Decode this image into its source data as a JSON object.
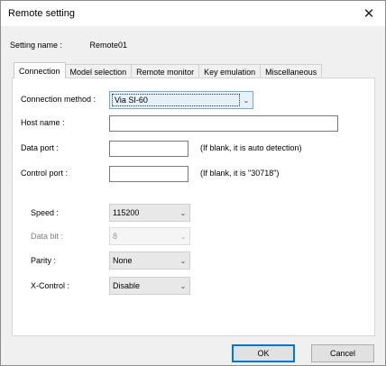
{
  "window": {
    "title": "Remote setting",
    "close_glyph": "✕"
  },
  "setting": {
    "label": "Setting name :",
    "value": "Remote01"
  },
  "tabs": [
    {
      "label": "Connection"
    },
    {
      "label": "Model selection"
    },
    {
      "label": "Remote monitor"
    },
    {
      "label": "Key emulation"
    },
    {
      "label": "Miscellaneous"
    }
  ],
  "connection": {
    "method_label": "Connection method :",
    "method_value": "Via SI-60",
    "host_label": "Host name :",
    "host_value": "",
    "data_port_label": "Data port :",
    "data_port_value": "",
    "data_port_hint": "(If blank, it is auto detection)",
    "control_port_label": "Control port :",
    "control_port_value": "",
    "control_port_hint": "(If blank, it is \"30718\")",
    "speed_label": "Speed :",
    "speed_value": "115200",
    "data_bit_label": "Data bit :",
    "data_bit_value": "8",
    "parity_label": "Parity :",
    "parity_value": "None",
    "xcontrol_label": "X-Control :",
    "xcontrol_value": "Disable"
  },
  "buttons": {
    "ok": "OK",
    "cancel": "Cancel"
  },
  "icons": {
    "chevron": "chevron-down-icon",
    "close": "close-icon"
  },
  "colors": {
    "focus_border": "#0078d7",
    "panel_bg": "#ffffff",
    "window_bg": "#f0f0f0"
  }
}
